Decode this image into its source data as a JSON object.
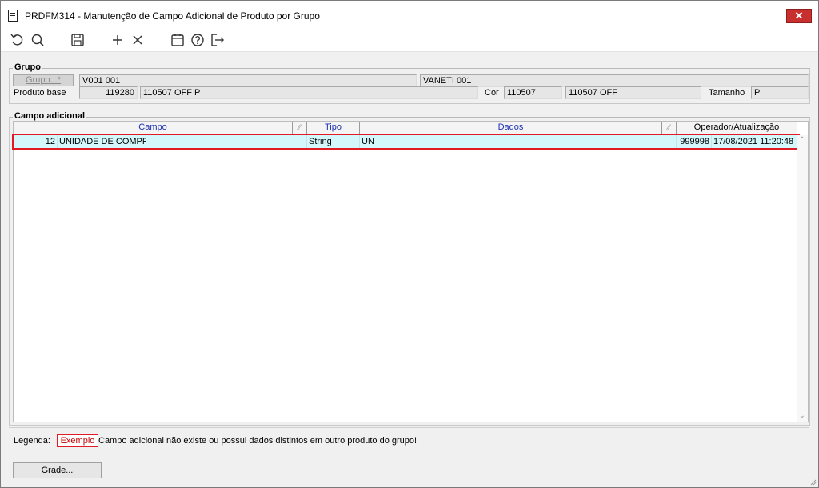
{
  "window": {
    "title": "PRDFM314 - Manutenção de Campo Adicional de Produto por Grupo",
    "close_label": "✕"
  },
  "toolbar": {
    "icons": [
      "refresh-icon",
      "search-icon",
      "save-icon",
      "add-icon",
      "delete-icon",
      "calendar-icon",
      "help-icon",
      "exit-icon"
    ]
  },
  "grupo": {
    "section_label": "Grupo",
    "grupo_button": "Grupo...*",
    "grupo_code": "V001 001",
    "grupo_desc": "VANETI 001",
    "produto_base_label": "Produto base",
    "produto_base_code": "119280",
    "produto_base_desc": "110507 OFF P",
    "cor_label": "Cor",
    "cor_code": "110507",
    "cor_desc": "110507 OFF",
    "tamanho_label": "Tamanho",
    "tamanho_value": "P"
  },
  "campo_adicional": {
    "section_label": "Campo adicional",
    "columns": {
      "campo": "Campo",
      "tipo": "Tipo",
      "dados": "Dados",
      "operador": "Operador/Atualização"
    },
    "sort_mark": "⁄⁄",
    "rows": [
      {
        "num": "12",
        "campo": "UNIDADE DE COMPRA",
        "tipo": "String",
        "dados": "UN",
        "operador": "999998",
        "atualizacao": "17/08/2021 11:20:48"
      }
    ]
  },
  "legend": {
    "label": "Legenda:",
    "sample": "Exemplo",
    "text": "Campo adicional não existe ou possui dados distintos em outro produto do grupo!"
  },
  "bottom": {
    "grade_button": "Grade..."
  },
  "colors": {
    "highlight_row": "#d3f7fb",
    "error_outline": "#e01b24",
    "header_text": "#1d2fb3",
    "close_button": "#c7302e"
  }
}
